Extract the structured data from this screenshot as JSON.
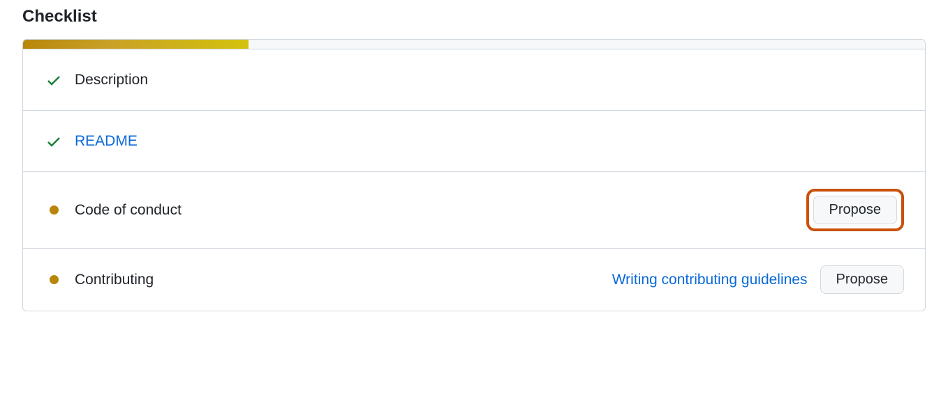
{
  "title": "Checklist",
  "progress_percent": 25,
  "items": [
    {
      "icon": "check",
      "label": "Description",
      "is_link": false,
      "help_text": null,
      "action": null,
      "highlighted": false
    },
    {
      "icon": "check",
      "label": "README",
      "is_link": true,
      "help_text": null,
      "action": null,
      "highlighted": false
    },
    {
      "icon": "dot",
      "label": "Code of conduct",
      "is_link": false,
      "help_text": null,
      "action": "Propose",
      "highlighted": true
    },
    {
      "icon": "dot",
      "label": "Contributing",
      "is_link": false,
      "help_text": "Writing contributing guidelines",
      "action": "Propose",
      "highlighted": false
    }
  ]
}
